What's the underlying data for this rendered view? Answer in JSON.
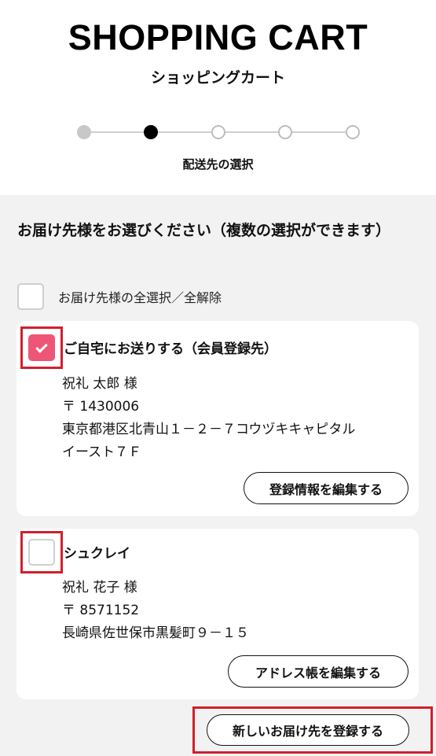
{
  "header": {
    "title": "SHOPPING CART",
    "subtitle": "ショッピングカート"
  },
  "stepper": {
    "current_step_label": "配送先の選択",
    "steps": [
      "done",
      "current",
      "pending",
      "pending",
      "pending"
    ]
  },
  "instruction": "お届け先様をお選びください（複数の選択ができます）",
  "select_all": {
    "label": "お届け先様の全選択／全解除",
    "checked": false
  },
  "addresses": [
    {
      "title": "ご自宅にお送りする（会員登録先）",
      "name": "祝礼 太郎 様",
      "postal": "〒 1430006",
      "address_line1": "東京都港区北青山１－２－７コウヅキキャピタル",
      "address_line2": "イースト７Ｆ",
      "checked": true,
      "button_label": "登録情報を編集する"
    },
    {
      "title": "シュクレイ",
      "name": "祝礼 花子 様",
      "postal": "〒 8571152",
      "address_line1": "長崎県佐世保市黒髪町９－１５",
      "checked": false,
      "button_label": "アドレス帳を編集する"
    }
  ],
  "new_address_button": "新しいお届け先を登録する",
  "colors": {
    "accent_checkbox": "#ee5577",
    "highlight_frame": "#d11f2d",
    "content_background": "#f2f2f2"
  }
}
